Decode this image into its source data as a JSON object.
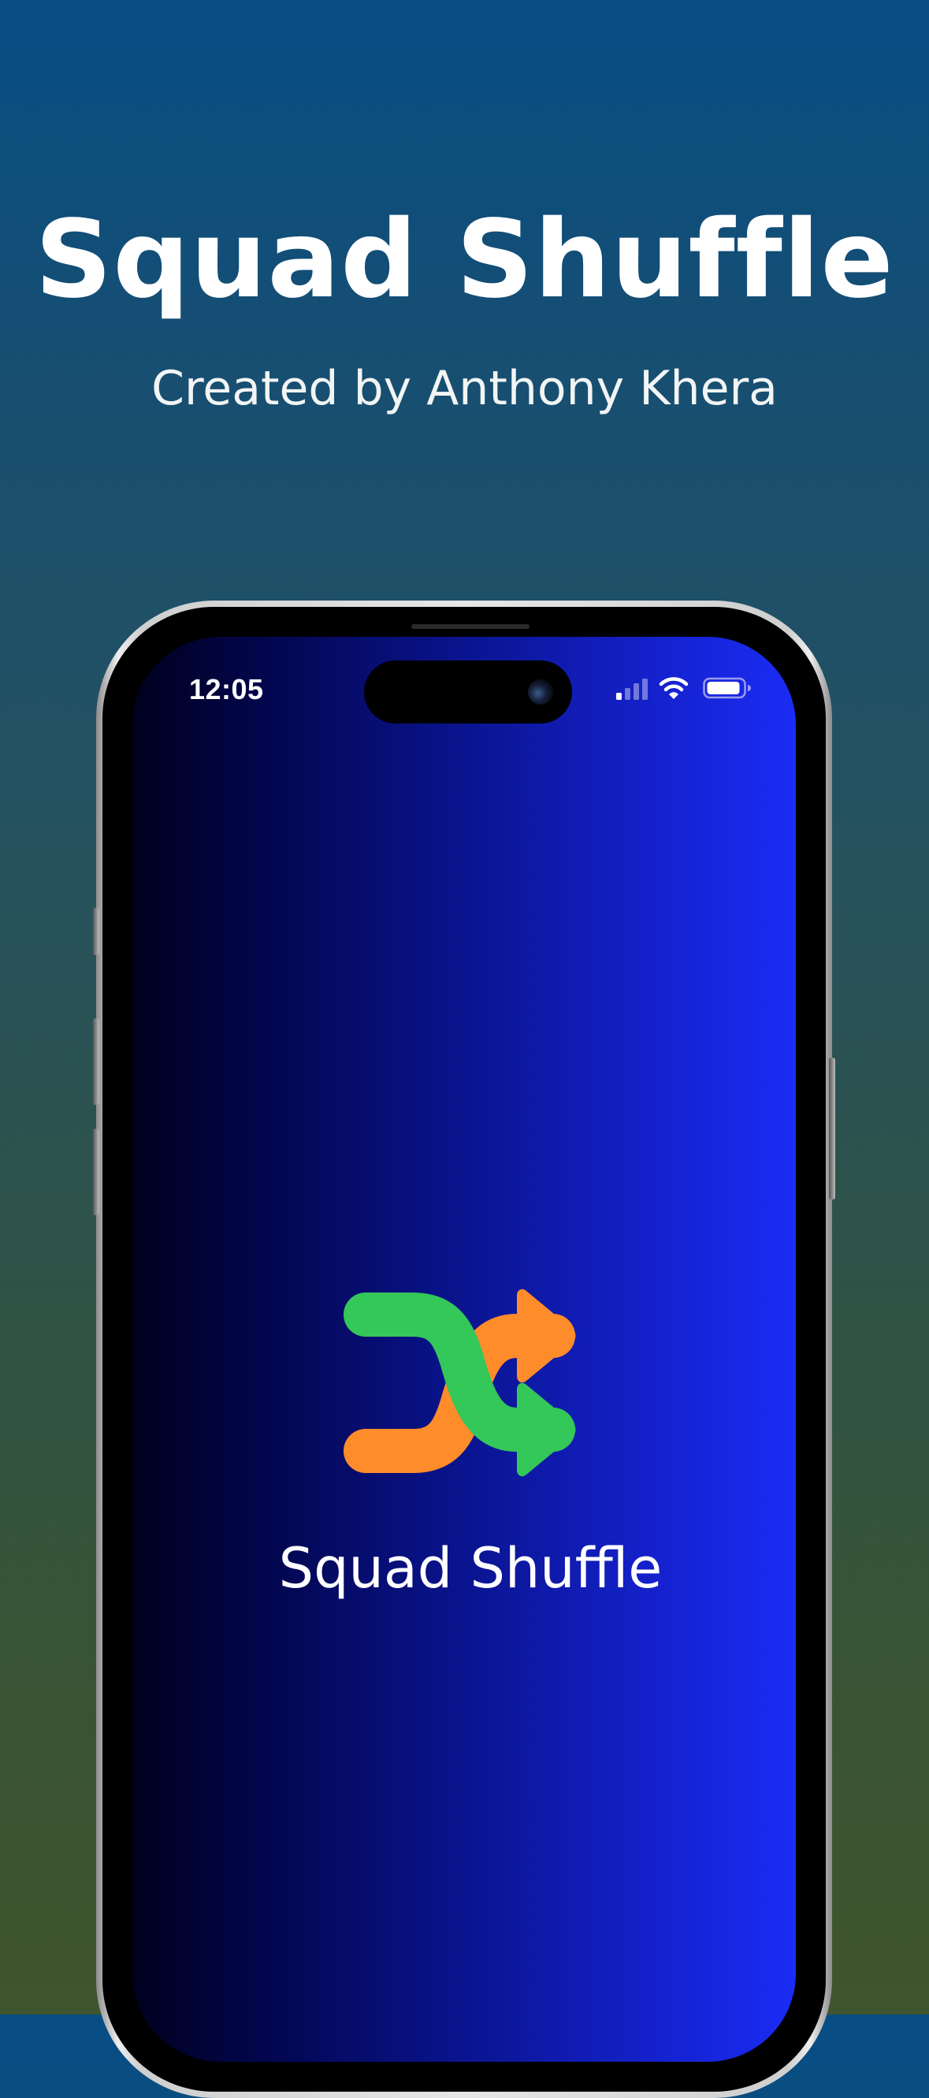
{
  "promo": {
    "title": "Squad Shuffle",
    "subtitle": "Created by Anthony Khera"
  },
  "status_bar": {
    "time": "12:05",
    "icons": [
      "cellular-signal-icon",
      "wifi-icon",
      "battery-icon"
    ]
  },
  "app": {
    "name": "Squad Shuffle",
    "logo_icon": "shuffle-icon"
  },
  "colors": {
    "background_top": "#074d84",
    "background_bottom": "#40542d",
    "screen_left": "#00001e",
    "screen_right": "#1b2cf5",
    "logo_green": "#34c759",
    "logo_orange": "#ff8c2a",
    "text": "#ffffff"
  }
}
